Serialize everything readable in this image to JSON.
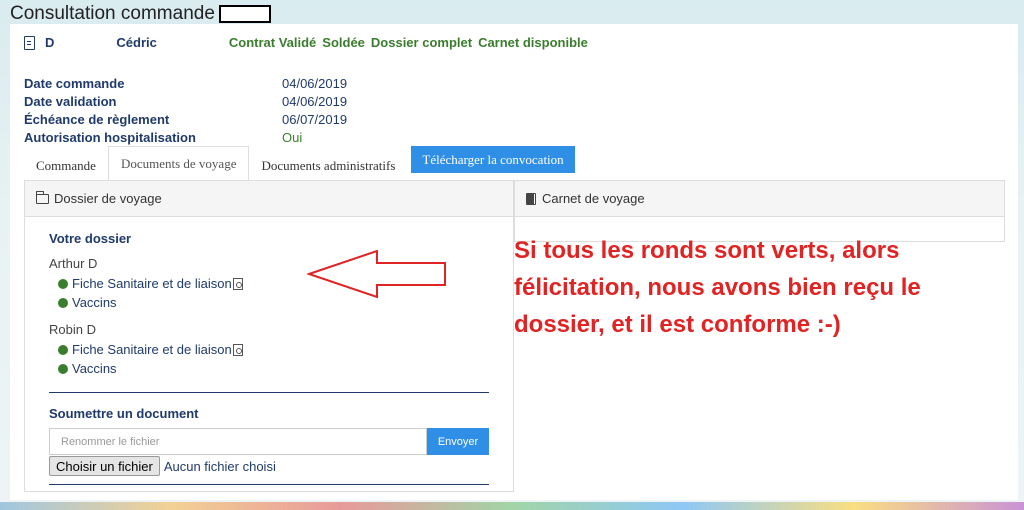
{
  "page": {
    "title": "Consultation commande"
  },
  "header": {
    "client_initial": "D",
    "client_firstname": "Cédric",
    "statuses": [
      "Contrat Validé",
      "Soldée",
      "Dossier complet",
      "Carnet disponible"
    ]
  },
  "info": [
    {
      "label": "Date commande",
      "value": "04/06/2019"
    },
    {
      "label": "Date validation",
      "value": "04/06/2019"
    },
    {
      "label": "Échéance de règlement",
      "value": "06/07/2019"
    },
    {
      "label": "Autorisation hospitalisation",
      "value": "Oui"
    }
  ],
  "tabs": {
    "commande": "Commande",
    "documents_voyage": "Documents de voyage",
    "documents_admin": "Documents administratifs",
    "download": "Télécharger la convocation"
  },
  "left_panel": {
    "title": "Dossier de voyage",
    "section_title": "Votre dossier",
    "people": [
      {
        "name": "Arthur D",
        "docs": [
          "Fiche Sanitaire et de liaison",
          "Vaccins"
        ]
      },
      {
        "name": "Robin D",
        "docs": [
          "Fiche Sanitaire et de liaison",
          "Vaccins"
        ]
      }
    ],
    "upload_title": "Soumettre un document",
    "rename_placeholder": "Renommer le fichier",
    "send_label": "Envoyer",
    "choose_label": "Choisir un fichier",
    "no_file_label": "Aucun fichier choisi"
  },
  "right_panel": {
    "title": "Carnet de voyage"
  },
  "annotation": {
    "lines": [
      "Si tous les ronds sont verts, alors",
      "félicitation, nous avons bien reçu le",
      "dossier, et il est conforme :-)"
    ],
    "color": "#e02424"
  },
  "colors": {
    "accent": "#2f8fe6",
    "status_green": "#3b7d2e",
    "navy": "#1f3a6b"
  }
}
